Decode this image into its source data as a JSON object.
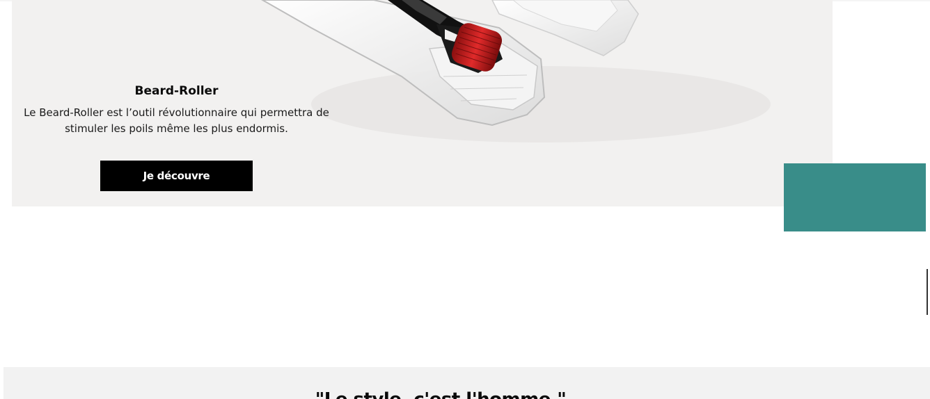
{
  "product": {
    "title": "Beard-Roller",
    "description": "Le Beard-Roller est l’outil révolutionnaire qui permettra de stimuler les poils même les plus endormis.",
    "cta_label": "Je découvre",
    "image_icon": "beard-roller-product-image"
  },
  "quote_section": {
    "text": "\"Le style, c'est l'homme.\""
  },
  "colors": {
    "banner_bg": "#f2f1f0",
    "button_bg": "#000000",
    "widget_teal": "#398d89",
    "quote_bg": "#f2f2f2"
  }
}
